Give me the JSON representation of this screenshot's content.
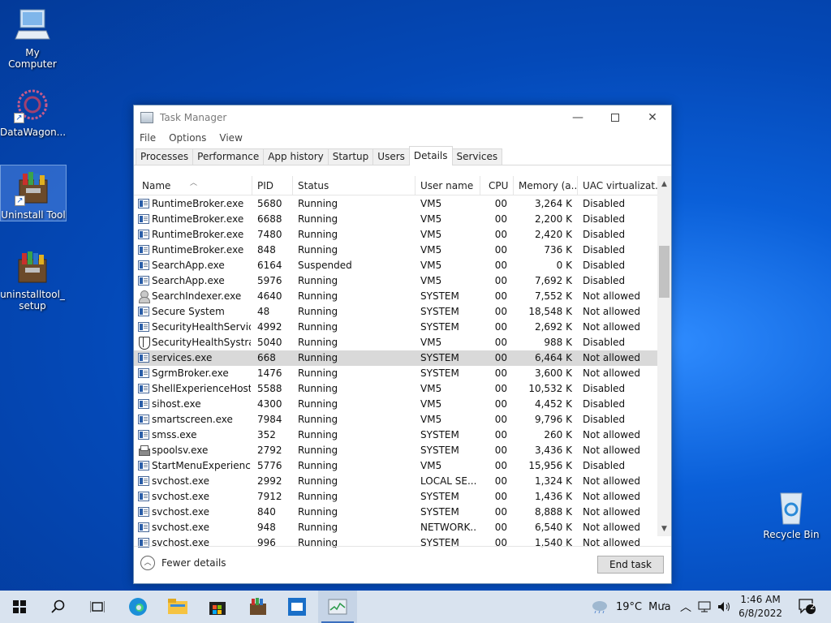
{
  "desktop": {
    "icons": [
      {
        "label": "My Computer"
      },
      {
        "label": "DataWagon..."
      },
      {
        "label": "Uninstall Tool"
      },
      {
        "label": "uninstalltool_\nsetup"
      },
      {
        "label": "Recycle Bin"
      }
    ]
  },
  "window": {
    "title": "Task Manager",
    "menu": [
      "File",
      "Options",
      "View"
    ],
    "tabs": [
      "Processes",
      "Performance",
      "App history",
      "Startup",
      "Users",
      "Details",
      "Services"
    ],
    "active_tab": "Details",
    "columns": {
      "name": "Name",
      "pid": "PID",
      "status": "Status",
      "user": "User name",
      "cpu": "CPU",
      "memory": "Memory (a...",
      "uac": "UAC virtualizat..."
    },
    "rows": [
      {
        "icon": "process-icon",
        "name": "RuntimeBroker.exe",
        "pid": "5680",
        "status": "Running",
        "user": "VM5",
        "cpu": "00",
        "mem": "3,264 K",
        "uac": "Disabled"
      },
      {
        "icon": "process-icon",
        "name": "RuntimeBroker.exe",
        "pid": "6688",
        "status": "Running",
        "user": "VM5",
        "cpu": "00",
        "mem": "2,200 K",
        "uac": "Disabled"
      },
      {
        "icon": "process-icon",
        "name": "RuntimeBroker.exe",
        "pid": "7480",
        "status": "Running",
        "user": "VM5",
        "cpu": "00",
        "mem": "2,420 K",
        "uac": "Disabled"
      },
      {
        "icon": "process-icon",
        "name": "RuntimeBroker.exe",
        "pid": "848",
        "status": "Running",
        "user": "VM5",
        "cpu": "00",
        "mem": "736 K",
        "uac": "Disabled"
      },
      {
        "icon": "process-icon",
        "name": "SearchApp.exe",
        "pid": "6164",
        "status": "Suspended",
        "user": "VM5",
        "cpu": "00",
        "mem": "0 K",
        "uac": "Disabled"
      },
      {
        "icon": "process-icon",
        "name": "SearchApp.exe",
        "pid": "5976",
        "status": "Running",
        "user": "VM5",
        "cpu": "00",
        "mem": "7,692 K",
        "uac": "Disabled"
      },
      {
        "icon": "user-icon",
        "name": "SearchIndexer.exe",
        "pid": "4640",
        "status": "Running",
        "user": "SYSTEM",
        "cpu": "00",
        "mem": "7,552 K",
        "uac": "Not allowed"
      },
      {
        "icon": "process-icon",
        "name": "Secure System",
        "pid": "48",
        "status": "Running",
        "user": "SYSTEM",
        "cpu": "00",
        "mem": "18,548 K",
        "uac": "Not allowed"
      },
      {
        "icon": "process-icon",
        "name": "SecurityHealthServic...",
        "pid": "4992",
        "status": "Running",
        "user": "SYSTEM",
        "cpu": "00",
        "mem": "2,692 K",
        "uac": "Not allowed"
      },
      {
        "icon": "shield-icon",
        "name": "SecurityHealthSystra...",
        "pid": "5040",
        "status": "Running",
        "user": "VM5",
        "cpu": "00",
        "mem": "988 K",
        "uac": "Disabled"
      },
      {
        "icon": "process-icon",
        "name": "services.exe",
        "pid": "668",
        "status": "Running",
        "user": "SYSTEM",
        "cpu": "00",
        "mem": "6,464 K",
        "uac": "Not allowed",
        "selected": true
      },
      {
        "icon": "process-icon",
        "name": "SgrmBroker.exe",
        "pid": "1476",
        "status": "Running",
        "user": "SYSTEM",
        "cpu": "00",
        "mem": "3,600 K",
        "uac": "Not allowed"
      },
      {
        "icon": "process-icon",
        "name": "ShellExperienceHost....",
        "pid": "5588",
        "status": "Running",
        "user": "VM5",
        "cpu": "00",
        "mem": "10,532 K",
        "uac": "Disabled"
      },
      {
        "icon": "process-icon",
        "name": "sihost.exe",
        "pid": "4300",
        "status": "Running",
        "user": "VM5",
        "cpu": "00",
        "mem": "4,452 K",
        "uac": "Disabled"
      },
      {
        "icon": "process-icon",
        "name": "smartscreen.exe",
        "pid": "7984",
        "status": "Running",
        "user": "VM5",
        "cpu": "00",
        "mem": "9,796 K",
        "uac": "Disabled"
      },
      {
        "icon": "process-icon",
        "name": "smss.exe",
        "pid": "352",
        "status": "Running",
        "user": "SYSTEM",
        "cpu": "00",
        "mem": "260 K",
        "uac": "Not allowed"
      },
      {
        "icon": "printer-icon",
        "name": "spoolsv.exe",
        "pid": "2792",
        "status": "Running",
        "user": "SYSTEM",
        "cpu": "00",
        "mem": "3,436 K",
        "uac": "Not allowed"
      },
      {
        "icon": "process-icon",
        "name": "StartMenuExperienc...",
        "pid": "5776",
        "status": "Running",
        "user": "VM5",
        "cpu": "00",
        "mem": "15,956 K",
        "uac": "Disabled"
      },
      {
        "icon": "process-icon",
        "name": "svchost.exe",
        "pid": "2992",
        "status": "Running",
        "user": "LOCAL SE...",
        "cpu": "00",
        "mem": "1,324 K",
        "uac": "Not allowed"
      },
      {
        "icon": "process-icon",
        "name": "svchost.exe",
        "pid": "7912",
        "status": "Running",
        "user": "SYSTEM",
        "cpu": "00",
        "mem": "1,436 K",
        "uac": "Not allowed"
      },
      {
        "icon": "process-icon",
        "name": "svchost.exe",
        "pid": "840",
        "status": "Running",
        "user": "SYSTEM",
        "cpu": "00",
        "mem": "8,888 K",
        "uac": "Not allowed"
      },
      {
        "icon": "process-icon",
        "name": "svchost.exe",
        "pid": "948",
        "status": "Running",
        "user": "NETWORK...",
        "cpu": "00",
        "mem": "6,540 K",
        "uac": "Not allowed"
      },
      {
        "icon": "process-icon",
        "name": "svchost.exe",
        "pid": "996",
        "status": "Running",
        "user": "SYSTEM",
        "cpu": "00",
        "mem": "1,540 K",
        "uac": "Not allowed"
      }
    ],
    "footer": {
      "fewer_details": "Fewer details",
      "end_task": "End task"
    }
  },
  "taskbar": {
    "weather_temp": "19°C",
    "weather_text": "Mưa",
    "time": "1:46 AM",
    "date": "6/8/2022",
    "notification_count": "2"
  },
  "colors": {
    "selected_row": "#d9d9d9",
    "taskbar": "#d9e3ef",
    "desktop": "#0a5fd8"
  }
}
